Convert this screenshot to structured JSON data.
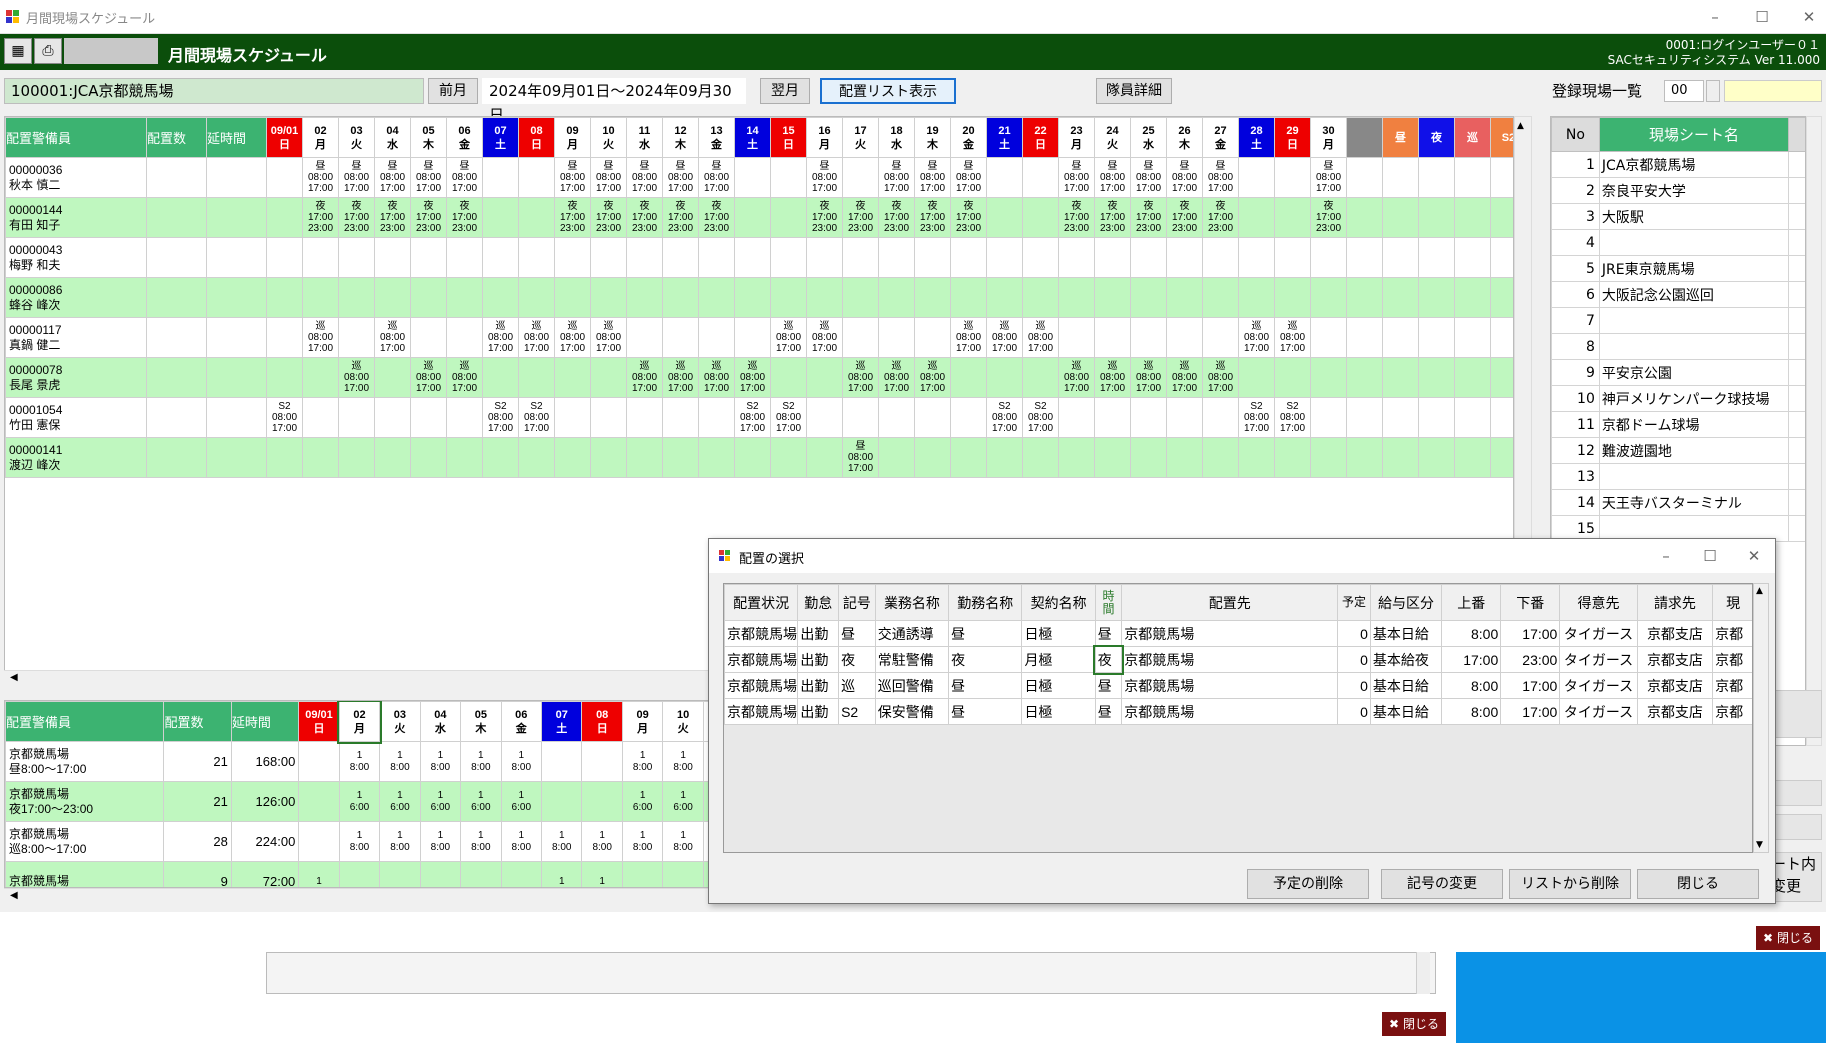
{
  "window": {
    "title": "月間現場スケジュール"
  },
  "header": {
    "title": "月間現場スケジュール",
    "user_line1": "0001:ログインユーザー０１",
    "user_line2": "SACセキュリティシステム Ver 11.000"
  },
  "toolbar": {
    "site": "100001:JCA京都競馬場",
    "prev": "前月",
    "period": "2024年09月01日～2024年09月30日",
    "next": "翌月",
    "list_btn": "配置リスト表示",
    "detail_btn": "隊員詳細"
  },
  "top_grid": {
    "head": {
      "guard": "配置警備員",
      "count": "配置数",
      "hours": "延時間"
    },
    "days": [
      [
        "09/01",
        "日",
        "sun"
      ],
      [
        "02",
        "月",
        ""
      ],
      [
        "03",
        "火",
        ""
      ],
      [
        "04",
        "水",
        ""
      ],
      [
        "05",
        "木",
        ""
      ],
      [
        "06",
        "金",
        ""
      ],
      [
        "07",
        "土",
        "sat"
      ],
      [
        "08",
        "日",
        "sun"
      ],
      [
        "09",
        "月",
        ""
      ],
      [
        "10",
        "火",
        ""
      ],
      [
        "11",
        "水",
        ""
      ],
      [
        "12",
        "木",
        ""
      ],
      [
        "13",
        "金",
        ""
      ],
      [
        "14",
        "土",
        "sat"
      ],
      [
        "15",
        "日",
        "sun"
      ],
      [
        "16",
        "月",
        ""
      ],
      [
        "17",
        "火",
        ""
      ],
      [
        "18",
        "水",
        ""
      ],
      [
        "19",
        "木",
        ""
      ],
      [
        "20",
        "金",
        ""
      ],
      [
        "21",
        "土",
        "sat"
      ],
      [
        "22",
        "日",
        "sun"
      ],
      [
        "23",
        "月",
        ""
      ],
      [
        "24",
        "火",
        ""
      ],
      [
        "25",
        "水",
        ""
      ],
      [
        "26",
        "木",
        ""
      ],
      [
        "27",
        "金",
        ""
      ],
      [
        "28",
        "土",
        "sat"
      ],
      [
        "29",
        "日",
        "sun"
      ],
      [
        "30",
        "月",
        ""
      ]
    ],
    "extra": [
      [
        "",
        "gry"
      ],
      [
        "昼",
        "org"
      ],
      [
        "夜",
        "blu"
      ],
      [
        "巡",
        "mag"
      ],
      [
        "S2",
        "org"
      ]
    ],
    "rows": [
      {
        "id": "00000036",
        "name": "秋本 慎二",
        "shifts": {
          "02": [
            "昼",
            "08:00",
            "17:00"
          ],
          "03": [
            "昼",
            "08:00",
            "17:00"
          ],
          "04": [
            "昼",
            "08:00",
            "17:00"
          ],
          "05": [
            "昼",
            "08:00",
            "17:00"
          ],
          "06": [
            "昼",
            "08:00",
            "17:00"
          ],
          "09": [
            "昼",
            "08:00",
            "17:00"
          ],
          "10": [
            "昼",
            "08:00",
            "17:00"
          ],
          "11": [
            "昼",
            "08:00",
            "17:00"
          ],
          "12": [
            "昼",
            "08:00",
            "17:00"
          ],
          "13": [
            "昼",
            "08:00",
            "17:00"
          ],
          "16": [
            "昼",
            "08:00",
            "17:00"
          ],
          "18": [
            "昼",
            "08:00",
            "17:00"
          ],
          "19": [
            "昼",
            "08:00",
            "17:00"
          ],
          "20": [
            "昼",
            "08:00",
            "17:00"
          ],
          "23": [
            "昼",
            "08:00",
            "17:00"
          ],
          "24": [
            "昼",
            "08:00",
            "17:00"
          ],
          "25": [
            "昼",
            "08:00",
            "17:00"
          ],
          "26": [
            "昼",
            "08:00",
            "17:00"
          ],
          "27": [
            "昼",
            "08:00",
            "17:00"
          ],
          "30": [
            "昼",
            "08:00",
            "17:00"
          ]
        }
      },
      {
        "id": "00000144",
        "name": "有田 知子",
        "shifts": {
          "02": [
            "夜",
            "17:00",
            "23:00"
          ],
          "03": [
            "夜",
            "17:00",
            "23:00"
          ],
          "04": [
            "夜",
            "17:00",
            "23:00"
          ],
          "05": [
            "夜",
            "17:00",
            "23:00"
          ],
          "06": [
            "夜",
            "17:00",
            "23:00"
          ],
          "09": [
            "夜",
            "17:00",
            "23:00"
          ],
          "10": [
            "夜",
            "17:00",
            "23:00"
          ],
          "11": [
            "夜",
            "17:00",
            "23:00"
          ],
          "12": [
            "夜",
            "17:00",
            "23:00"
          ],
          "13": [
            "夜",
            "17:00",
            "23:00"
          ],
          "16": [
            "夜",
            "17:00",
            "23:00"
          ],
          "17": [
            "夜",
            "17:00",
            "23:00"
          ],
          "18": [
            "夜",
            "17:00",
            "23:00"
          ],
          "19": [
            "夜",
            "17:00",
            "23:00"
          ],
          "20": [
            "夜",
            "17:00",
            "23:00"
          ],
          "23": [
            "夜",
            "17:00",
            "23:00"
          ],
          "24": [
            "夜",
            "17:00",
            "23:00"
          ],
          "25": [
            "夜",
            "17:00",
            "23:00"
          ],
          "26": [
            "夜",
            "17:00",
            "23:00"
          ],
          "27": [
            "夜",
            "17:00",
            "23:00"
          ],
          "30": [
            "夜",
            "17:00",
            "23:00"
          ]
        }
      },
      {
        "id": "00000043",
        "name": "梅野 和夫",
        "shifts": {}
      },
      {
        "id": "00000086",
        "name": "蜂谷 峰次",
        "shifts": {}
      },
      {
        "id": "00000117",
        "name": "真鍋 健二",
        "shifts": {
          "02": [
            "巡",
            "08:00",
            "17:00"
          ],
          "04": [
            "巡",
            "08:00",
            "17:00"
          ],
          "07": [
            "巡",
            "08:00",
            "17:00"
          ],
          "08": [
            "巡",
            "08:00",
            "17:00"
          ],
          "09": [
            "巡",
            "08:00",
            "17:00"
          ],
          "10": [
            "巡",
            "08:00",
            "17:00"
          ],
          "15": [
            "巡",
            "08:00",
            "17:00"
          ],
          "16": [
            "巡",
            "08:00",
            "17:00"
          ],
          "20": [
            "巡",
            "08:00",
            "17:00"
          ],
          "21": [
            "巡",
            "08:00",
            "17:00"
          ],
          "22": [
            "巡",
            "08:00",
            "17:00"
          ],
          "28": [
            "巡",
            "08:00",
            "17:00"
          ],
          "29": [
            "巡",
            "08:00",
            "17:00"
          ]
        }
      },
      {
        "id": "00000078",
        "name": "長尾 景虎",
        "shifts": {
          "03": [
            "巡",
            "08:00",
            "17:00"
          ],
          "05": [
            "巡",
            "08:00",
            "17:00"
          ],
          "06": [
            "巡",
            "08:00",
            "17:00"
          ],
          "11": [
            "巡",
            "08:00",
            "17:00"
          ],
          "12": [
            "巡",
            "08:00",
            "17:00"
          ],
          "13": [
            "巡",
            "08:00",
            "17:00"
          ],
          "14": [
            "巡",
            "08:00",
            "17:00"
          ],
          "17": [
            "巡",
            "08:00",
            "17:00"
          ],
          "18": [
            "巡",
            "08:00",
            "17:00"
          ],
          "19": [
            "巡",
            "08:00",
            "17:00"
          ],
          "23": [
            "巡",
            "08:00",
            "17:00"
          ],
          "24": [
            "巡",
            "08:00",
            "17:00"
          ],
          "25": [
            "巡",
            "08:00",
            "17:00"
          ],
          "26": [
            "巡",
            "08:00",
            "17:00"
          ],
          "27": [
            "巡",
            "08:00",
            "17:00"
          ]
        }
      },
      {
        "id": "00001054",
        "name": "竹田 憲保",
        "shifts": {
          "09/01": [
            "S2",
            "08:00",
            "17:00"
          ],
          "07": [
            "S2",
            "08:00",
            "17:00"
          ],
          "08": [
            "S2",
            "08:00",
            "17:00"
          ],
          "14": [
            "S2",
            "08:00",
            "17:00"
          ],
          "15": [
            "S2",
            "08:00",
            "17:00"
          ],
          "21": [
            "S2",
            "08:00",
            "17:00"
          ],
          "22": [
            "S2",
            "08:00",
            "17:00"
          ],
          "28": [
            "S2",
            "08:00",
            "17:00"
          ],
          "29": [
            "S2",
            "08:00",
            "17:00"
          ]
        }
      },
      {
        "id": "00000141",
        "name": "渡辺 峰次",
        "shifts": {
          "17": [
            "昼",
            "08:00",
            "17:00"
          ]
        }
      }
    ]
  },
  "bottom_grid": {
    "head": {
      "guard": "配置警備員",
      "count": "配置数",
      "hours": "延時間"
    },
    "rows": [
      {
        "name1": "京都競馬場",
        "name2": "昼8:00～17:00",
        "count": "21",
        "hours": "168:00",
        "time": "8:00"
      },
      {
        "name1": "京都競馬場",
        "name2": "夜17:00～23:00",
        "count": "21",
        "hours": "126:00",
        "time": "6:00"
      },
      {
        "name1": "京都競馬場",
        "name2": "巡8:00～17:00",
        "count": "28",
        "hours": "224:00",
        "time": "8:00"
      },
      {
        "name1": "京都競馬場",
        "name2": "",
        "count": "9",
        "hours": "72:00",
        "time": ""
      }
    ]
  },
  "right_panel": {
    "title": "登録現場一覧",
    "code": "00",
    "col_no": "No",
    "col_name": "現場シート名",
    "items": [
      [
        "1",
        "JCA京都競馬場"
      ],
      [
        "2",
        "奈良平安大学"
      ],
      [
        "3",
        "大阪駅"
      ],
      [
        "4",
        ""
      ],
      [
        "5",
        "JRE東京競馬場"
      ],
      [
        "6",
        "大阪記念公園巡回"
      ],
      [
        "7",
        ""
      ],
      [
        "8",
        ""
      ],
      [
        "9",
        "平安京公園"
      ],
      [
        "10",
        "神戸メリケンパーク球技場"
      ],
      [
        "11",
        "京都ドーム球場"
      ],
      [
        "12",
        "難波遊園地"
      ],
      [
        "13",
        ""
      ],
      [
        "14",
        "天王寺バスターミナル"
      ],
      [
        "15",
        ""
      ]
    ],
    "partial1": "ート内",
    "partial2": "変更"
  },
  "dialog": {
    "title": "配置の選択",
    "cols": [
      "配置状況",
      "勤怠",
      "記号",
      "業務名称",
      "勤務名称",
      "契約名称",
      "時間",
      "配置先",
      "予定",
      "給与区分",
      "上番",
      "下番",
      "得意先",
      "請求先",
      "現"
    ],
    "rows": [
      [
        "京都競馬場",
        "出勤",
        "昼",
        "交通誘導",
        "昼",
        "日極",
        "昼",
        "京都競馬場",
        "0",
        "基本日給",
        "8:00",
        "17:00",
        "タイガース",
        "京都支店",
        "京都"
      ],
      [
        "京都競馬場",
        "出勤",
        "夜",
        "常駐警備",
        "夜",
        "月極",
        "夜",
        "京都競馬場",
        "0",
        "基本給夜",
        "17:00",
        "23:00",
        "タイガース",
        "京都支店",
        "京都"
      ],
      [
        "京都競馬場",
        "出勤",
        "巡",
        "巡回警備",
        "昼",
        "日極",
        "昼",
        "京都競馬場",
        "0",
        "基本日給",
        "8:00",
        "17:00",
        "タイガース",
        "京都支店",
        "京都"
      ],
      [
        "京都競馬場",
        "出勤",
        "S2",
        "保安警備",
        "昼",
        "日極",
        "昼",
        "京都競馬場",
        "0",
        "基本日給",
        "8:00",
        "17:00",
        "タイガース",
        "京都支店",
        "京都"
      ]
    ],
    "buttons": {
      "del_plan": "予定の削除",
      "change": "記号の変更",
      "del_list": "リストから削除",
      "close": "閉じる"
    }
  },
  "close_labels": {
    "a": "閉じる",
    "b": "閉じる"
  }
}
